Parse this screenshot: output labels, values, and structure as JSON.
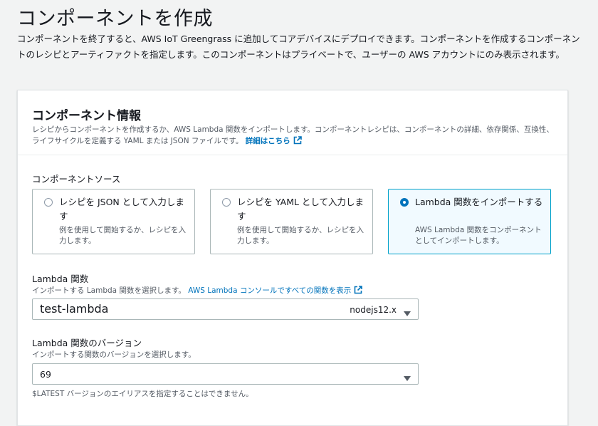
{
  "page": {
    "title": "コンポーネントを作成",
    "description": "コンポーネントを終了すると、AWS IoT Greengrass に追加してコアデバイスにデプロイできます。コンポーネントを作成するコンポーネントのレシピとアーティファクトを指定します。このコンポーネントはプライベートで、ユーザーの AWS アカウントにのみ表示されます。"
  },
  "panel": {
    "title": "コンポーネント情報",
    "description": "レシピからコンポーネントを作成するか、AWS Lambda 関数をインポートします。コンポーネントレシピは、コンポーネントの詳細、依存関係、互換性、ライフサイクルを定義する YAML または JSON ファイルです。",
    "learn_more": "詳細はこちら"
  },
  "source": {
    "label": "コンポーネントソース",
    "options": [
      {
        "title": "レシピを JSON として入力します",
        "description": "例を使用して開始するか、レシピを入力します。",
        "selected": false
      },
      {
        "title": "レシピを YAML として入力します",
        "description": "例を使用して開始するか、レシピを入力します。",
        "selected": false
      },
      {
        "title": "Lambda 関数をインポートする",
        "description": "AWS Lambda 関数をコンポーネントとしてインポートします。",
        "selected": true
      }
    ]
  },
  "lambda_function": {
    "label": "Lambda 関数",
    "description": "インポートする Lambda 関数を選択します。",
    "console_link": "AWS Lambda コンソールですべての関数を表示",
    "value": "test-lambda",
    "runtime": "nodejs12.x"
  },
  "lambda_version": {
    "label": "Lambda 関数のバージョン",
    "description": "インポートする関数のバージョンを選択します。",
    "value": "69",
    "constraint": "$LATEST バージョンのエイリアスを指定することはできません。"
  },
  "icons": {
    "external": "external-link-icon",
    "caret": "caret-down-icon"
  },
  "colors": {
    "link": "#0073bb",
    "selected_border": "#00a1c9",
    "selected_bg": "#f1faff"
  }
}
